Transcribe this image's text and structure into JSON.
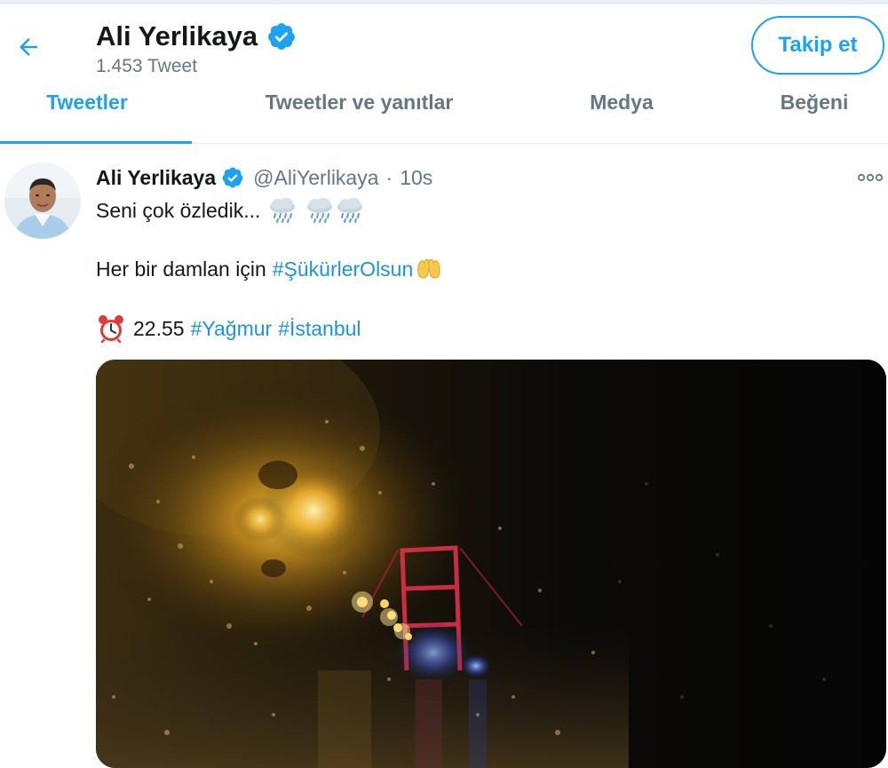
{
  "header": {
    "back_icon": "arrow-left-icon",
    "name": "Ali Yerlikaya",
    "verified_icon": "verified-badge-icon",
    "tweet_count": "1.453 Tweet",
    "follow_label": "Takip et"
  },
  "tabs": [
    {
      "label": "Tweetler",
      "active": true
    },
    {
      "label": "Tweetler ve yanıtlar",
      "active": false
    },
    {
      "label": "Medya",
      "active": false
    },
    {
      "label": "Beğeni",
      "active": false
    }
  ],
  "tweet": {
    "name": "Ali Yerlikaya",
    "handle": "@AliYerlikaya",
    "separator": "·",
    "time": "10s",
    "line1_text": "Seni çok özledik...",
    "line2_text": "Her bir damlan için",
    "line2_hashtag": "#ŞükürlerOlsun",
    "line3_time": "22.55",
    "line3_hashtag1": "#Yağmur",
    "line3_hashtag2": "#İstanbul",
    "icons": [
      "rain-cloud-icon",
      "clapping-hands-icon",
      "alarm-clock-icon",
      "more-options-icon"
    ]
  },
  "colors": {
    "accent": "#1da1f2",
    "hashtag": "#1b95e0",
    "secondary_text": "#657786",
    "border": "#e6ecf0"
  }
}
